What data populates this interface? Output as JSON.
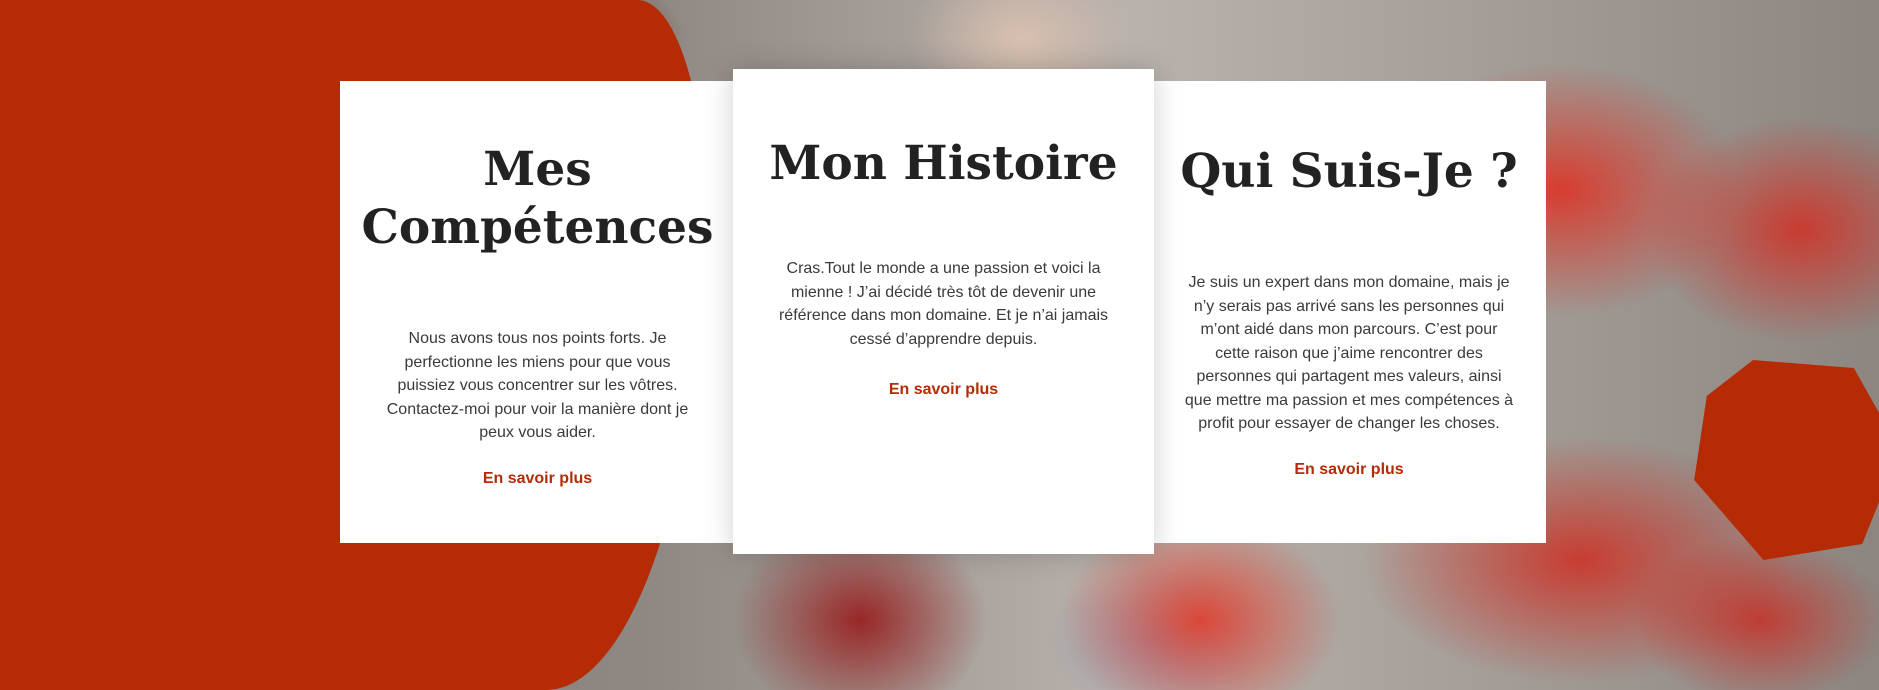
{
  "colors": {
    "accent": "#b52b06",
    "card_bg": "#ffffff",
    "heading": "#222222",
    "body_text": "#3a3a3a"
  },
  "cards": [
    {
      "title": "Mes Compétences",
      "text": "Nous avons tous nos points forts. Je perfectionne les miens pour que vous puissiez vous concentrer sur les vôtres. Contactez-moi pour voir la manière dont je peux vous aider.",
      "link": "En savoir plus"
    },
    {
      "title": "Mon Histoire",
      "text": "Cras.Tout le monde a une passion et voici la mienne ! J’ai décidé très tôt de devenir une référence dans mon domaine. Et je n’ai jamais cessé d’apprendre depuis.",
      "link": "En savoir plus"
    },
    {
      "title": "Qui Suis-Je ?",
      "text": "Je suis un expert dans mon domaine, mais je n’y serais pas arrivé sans les personnes qui m’ont aidé dans mon parcours. C’est pour cette raison que j’aime rencontrer des personnes qui partagent mes valeurs, ainsi que mettre ma passion et mes compétences à profit pour essayer de changer les choses.",
      "link": "En savoir plus"
    }
  ]
}
